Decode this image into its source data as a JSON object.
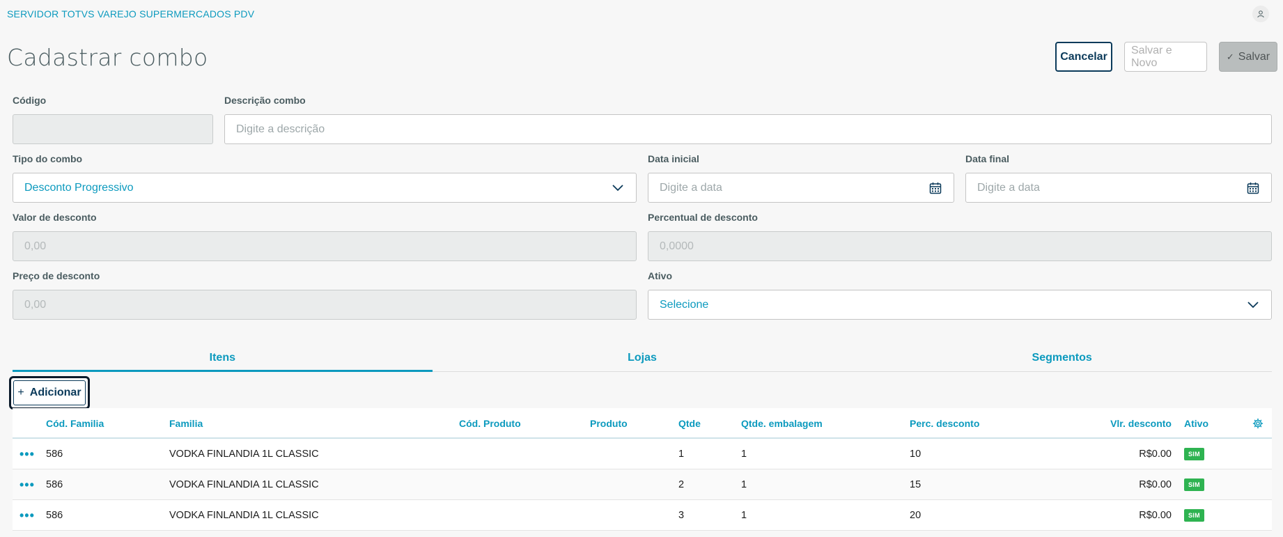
{
  "app": {
    "title": "SERVIDOR TOTVS VAREJO SUPERMERCADOS PDV",
    "user_icon": "user-icon"
  },
  "page": {
    "title": "Cadastrar combo"
  },
  "actions": {
    "cancel": "Cancelar",
    "save_new": "Salvar e Novo",
    "save": "Salvar"
  },
  "form": {
    "codigo": {
      "label": "Código",
      "value": ""
    },
    "descricao": {
      "label": "Descrição combo",
      "placeholder": "Digite a descrição"
    },
    "tipo": {
      "label": "Tipo do combo",
      "value": "Desconto Progressivo"
    },
    "data_inicial": {
      "label": "Data inicial",
      "placeholder": "Digite a data"
    },
    "data_final": {
      "label": "Data final",
      "placeholder": "Digite a data"
    },
    "valor_desconto": {
      "label": "Valor de desconto",
      "placeholder": "0,00"
    },
    "percentual_desconto": {
      "label": "Percentual de desconto",
      "placeholder": "0,0000"
    },
    "preco_desconto": {
      "label": "Preço de desconto",
      "placeholder": "0,00"
    },
    "ativo": {
      "label": "Ativo",
      "value": "Selecione"
    }
  },
  "tabs": [
    {
      "label": "Itens",
      "active": true
    },
    {
      "label": "Lojas",
      "active": false
    },
    {
      "label": "Segmentos",
      "active": false
    }
  ],
  "add_button": {
    "icon": "+",
    "label": "Adicionar"
  },
  "table": {
    "columns": {
      "cod_familia": "Cód. Familia",
      "familia": "Familia",
      "cod_produto": "Cód. Produto",
      "produto": "Produto",
      "qtde": "Qtde",
      "qtde_embalagem": "Qtde. embalagem",
      "perc_desconto": "Perc. desconto",
      "vlr_desconto": "Vlr. desconto",
      "ativo": "Ativo"
    },
    "rows": [
      {
        "actions": "•••",
        "cod_familia": "586",
        "familia": "VODKA FINLANDIA 1L CLASSIC",
        "cod_produto": "",
        "produto": "",
        "qtde": "1",
        "qtde_embalagem": "1",
        "perc_desconto": "10",
        "vlr_desconto": "R$0.00",
        "ativo": "SIM"
      },
      {
        "actions": "•••",
        "cod_familia": "586",
        "familia": "VODKA FINLANDIA 1L CLASSIC",
        "cod_produto": "",
        "produto": "",
        "qtde": "2",
        "qtde_embalagem": "1",
        "perc_desconto": "15",
        "vlr_desconto": "R$0.00",
        "ativo": "SIM"
      },
      {
        "actions": "•••",
        "cod_familia": "586",
        "familia": "VODKA FINLANDIA 1L CLASSIC",
        "cod_produto": "",
        "produto": "",
        "qtde": "3",
        "qtde_embalagem": "1",
        "perc_desconto": "20",
        "vlr_desconto": "R$0.00",
        "ativo": "SIM"
      }
    ]
  },
  "colors": {
    "accent": "#0c9abe",
    "primary_dark": "#0b3a5a",
    "success": "#2eb351"
  }
}
